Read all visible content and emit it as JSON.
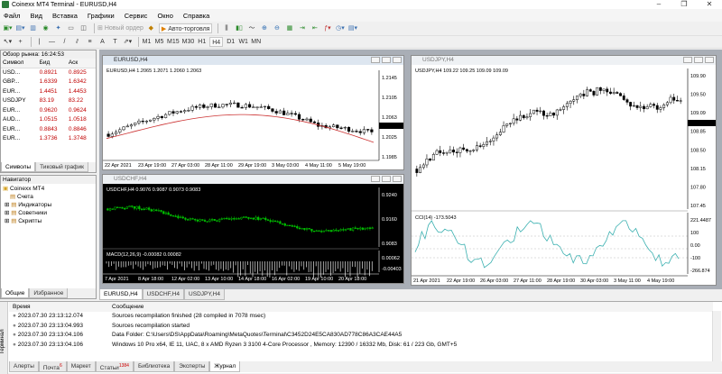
{
  "app": {
    "title": "Coinexx MT4 Terminal - EURUSD,H4"
  },
  "menu": [
    "Файл",
    "Вид",
    "Вставка",
    "Графики",
    "Сервис",
    "Окно",
    "Справка"
  ],
  "toolbar": {
    "new_order": "Новый ордер",
    "auto_trading": "Авто-торговля",
    "timeframes": [
      "M1",
      "M5",
      "M15",
      "M30",
      "H1",
      "H4",
      "D1",
      "W1",
      "MN"
    ]
  },
  "market_watch": {
    "title": "Обзор рынка: 16:24:53",
    "headers": [
      "Символ",
      "Бид",
      "Аск"
    ],
    "rows": [
      {
        "symbol": "USD...",
        "bid": "0.8921",
        "ask": "0.8925"
      },
      {
        "symbol": "GBP...",
        "bid": "1.6339",
        "ask": "1.6342"
      },
      {
        "symbol": "EUR...",
        "bid": "1.4451",
        "ask": "1.4453"
      },
      {
        "symbol": "USDJPY",
        "bid": "83.19",
        "ask": "83.22"
      },
      {
        "symbol": "EUR...",
        "bid": "0.9620",
        "ask": "0.9624"
      },
      {
        "symbol": "AUD...",
        "bid": "1.0515",
        "ask": "1.0518"
      },
      {
        "symbol": "EUR...",
        "bid": "0.8843",
        "ask": "0.8846"
      },
      {
        "symbol": "EUR...",
        "bid": "1.3736",
        "ask": "1.3748"
      }
    ],
    "tabs": [
      "Символы",
      "Тиковый график"
    ]
  },
  "navigator": {
    "title": "Навигатор",
    "root": "Coinexx MT4",
    "items": [
      "Счета",
      "Индикаторы",
      "Советники",
      "Скрипты"
    ],
    "tabs": [
      "Общие",
      "Избранное"
    ]
  },
  "charts": {
    "eurusd": {
      "title": "EURUSD,H4",
      "info": "EURUSD,H4 1.2065 1.2071 1.2060 1.2063",
      "yticks": [
        "1.2145",
        "1.2105",
        "1.2063",
        "1.2025",
        "1.1985"
      ],
      "xticks": [
        "22 Apr 2021",
        "23 Apr 19:00",
        "27 Apr 03:00",
        "28 Apr 11:00",
        "29 Apr 19:00",
        "3 May 03:00",
        "4 May 11:00",
        "5 May 19:00"
      ]
    },
    "usdchf": {
      "title": "USDCHF,H4",
      "info": "USDCHF,H4 0.9076 0.9087 0.9073 0.9083",
      "yticks": [
        "0.9240",
        "0.9160",
        "0.9083"
      ],
      "macd_info": "MACD(12,26,9) -0.00082 0.00082",
      "macd_yticks": [
        "0.00062",
        "-0.00403"
      ],
      "xticks": [
        "7 Apr 2021",
        "8 Apr 18:00",
        "12 Apr 02:00",
        "13 Apr 10:00",
        "14 Apr 18:00",
        "16 Apr 02:00",
        "19 Apr 10:00",
        "20 Apr 18:00"
      ]
    },
    "usdjpy": {
      "title": "USDJPY,H4",
      "info": "USDJPY,H4 109.22 109.25 109.09 109.09",
      "yticks": [
        "109.90",
        "109.50",
        "109.09",
        "108.85",
        "108.50",
        "108.15",
        "107.80",
        "107.45"
      ],
      "cci_info": "CCI(14) -173.5043",
      "cci_yticks": [
        "221.4487",
        "100",
        "0.00",
        "-100",
        "-266.874"
      ],
      "xticks": [
        "21 Apr 2021",
        "22 Apr 19:00",
        "26 Apr 03:00",
        "27 Apr 11:00",
        "28 Apr 19:00",
        "30 Apr 03:00",
        "3 May 11:00",
        "4 May 19:00"
      ]
    }
  },
  "chart_tabs": [
    "EURUSD,H4",
    "USDCHF,H4",
    "USDJPY,H4"
  ],
  "terminal": {
    "side_label": "Терминал",
    "headers": [
      "Время",
      "Сообщение"
    ],
    "rows": [
      {
        "time": "2023.07.30 23:13:12.074",
        "msg": "Sources recompilation finished (28 compiled in 7078 msec)"
      },
      {
        "time": "2023.07.30 23:13:04.993",
        "msg": "Sources recompilation started"
      },
      {
        "time": "2023.07.30 23:13:04.106",
        "msg": "Data Folder: C:\\Users\\DS\\AppData\\Roaming\\MetaQuotes\\Terminal\\C3452D24E5CA830AD778C86A3CAE44A5"
      },
      {
        "time": "2023.07.30 23:13:04.106",
        "msg": "Windows 10 Pro x64, IE 11, UAC, 8 x AMD Ryzen 3 3100 4-Core Processor , Memory: 12390 / 16332 Mb, Disk: 61 / 223 Gb, GMT+5"
      }
    ],
    "tabs": [
      "Алерты",
      "Почта",
      "Маркет",
      "Статьи",
      "Библиотека",
      "Эксперты",
      "Журнал"
    ],
    "mail_badge": "6",
    "articles_badge": "1384"
  },
  "colors": {
    "bid": "#c00000",
    "ma": "#cc3333",
    "cci": "#3ab0b0",
    "chf_candle": "#00c000"
  }
}
